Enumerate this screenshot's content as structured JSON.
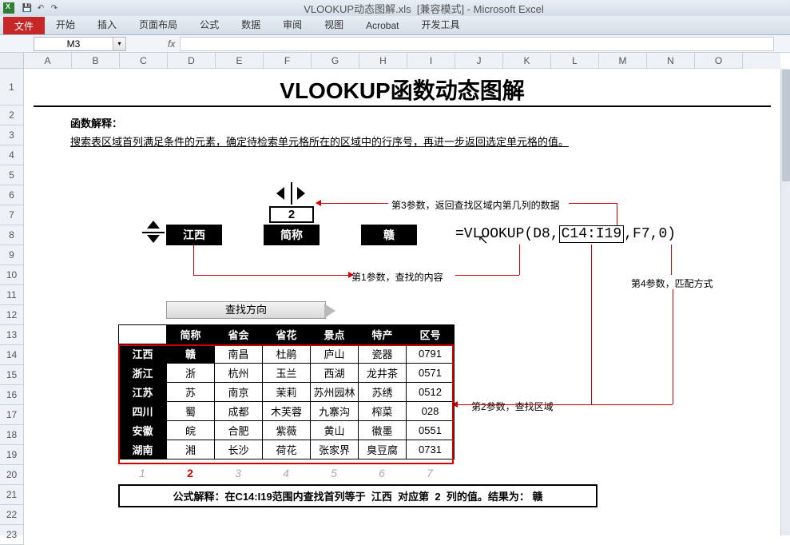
{
  "titlebar": {
    "filename": "VLOOKUP动态图解.xls",
    "mode": "[兼容模式]",
    "app": "Microsoft Excel"
  },
  "qat": {
    "save": "💾",
    "undo": "↶",
    "redo": "↷"
  },
  "ribbon": {
    "file": "文件",
    "tabs": [
      "开始",
      "插入",
      "页面布局",
      "公式",
      "数据",
      "审阅",
      "视图",
      "Acrobat",
      "开发工具"
    ]
  },
  "namebox": {
    "cell": "M3",
    "fx": "fx"
  },
  "columns": [
    "A",
    "B",
    "C",
    "D",
    "E",
    "F",
    "G",
    "H",
    "I",
    "J",
    "K",
    "L",
    "M",
    "N",
    "O"
  ],
  "rows": [
    "1",
    "2",
    "3",
    "4",
    "5",
    "6",
    "7",
    "8",
    "9",
    "10",
    "11",
    "12",
    "13",
    "14",
    "15",
    "16",
    "17",
    "18",
    "19",
    "20",
    "21",
    "22",
    "23"
  ],
  "doc": {
    "title": "VLOOKUP函数动态图解",
    "section_label": "函数解释：",
    "section_text": "搜索表区域首列满足条件的元素，确定待检索单元格所在的区域中的行序号，再进一步返回选定单元格的值。"
  },
  "diagram": {
    "box1": "江西",
    "num": "2",
    "box2": "简称",
    "box3": "赣",
    "formula_pre": "=VLOOKUP(D8,",
    "formula_range": "C14:I19",
    "formula_post": ",F7,0)",
    "anno_p1": "第1参数，查找的内容",
    "anno_p2": "第2参数，查找区域",
    "anno_p3": "第3参数，返回查找区域内第几列的数据",
    "anno_p4": "第4参数，匹配方式",
    "direction": "查找方向"
  },
  "table": {
    "headers": [
      "",
      "简称",
      "省会",
      "省花",
      "景点",
      "特产",
      "区号"
    ],
    "rows": [
      [
        "江西",
        "赣",
        "南昌",
        "杜鹃",
        "庐山",
        "瓷器",
        "0791"
      ],
      [
        "浙江",
        "浙",
        "杭州",
        "玉兰",
        "西湖",
        "龙井茶",
        "0571"
      ],
      [
        "江苏",
        "苏",
        "南京",
        "茉莉",
        "苏州园林",
        "苏绣",
        "0512"
      ],
      [
        "四川",
        "蜀",
        "成都",
        "木芙蓉",
        "九寨沟",
        "榨菜",
        "028"
      ],
      [
        "安徽",
        "皖",
        "合肥",
        "紫薇",
        "黄山",
        "徽墨",
        "0551"
      ],
      [
        "湖南",
        "湘",
        "长沙",
        "荷花",
        "张家界",
        "臭豆腐",
        "0731"
      ]
    ],
    "colnums": [
      "1",
      "2",
      "3",
      "4",
      "5",
      "6",
      "7"
    ],
    "active_col": 2
  },
  "result": {
    "prefix": "公式解释：在C14:I19范围内查找首列等于",
    "province": "江西",
    "mid": "对应第",
    "col": "2",
    "suffix1": "列的值。结果为：",
    "value": "赣"
  }
}
